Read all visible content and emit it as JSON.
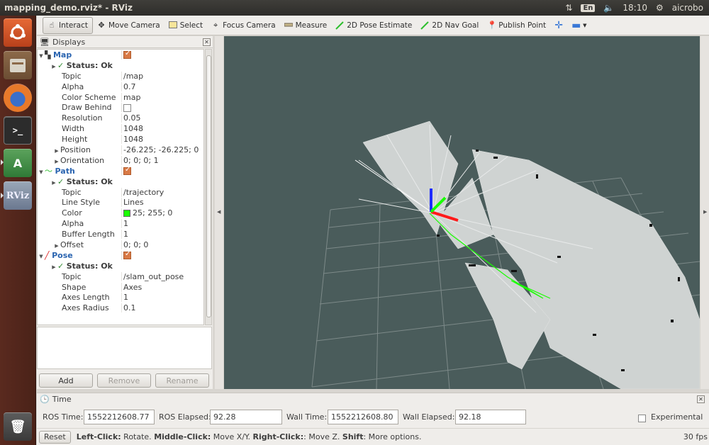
{
  "window": {
    "title": "mapping_demo.rviz* - RViz",
    "keyboard": "En",
    "clock": "18:10",
    "user": "aicrobo"
  },
  "launcher": {
    "terminal_glyph": ">_",
    "rviz_label": "RViz"
  },
  "toolbar": {
    "tools": [
      {
        "label": "Interact",
        "icon": "hand-pointer-icon"
      },
      {
        "label": "Move Camera",
        "icon": "move-camera-icon"
      },
      {
        "label": "Select",
        "icon": "select-box-icon"
      },
      {
        "label": "Focus Camera",
        "icon": "crosshair-icon"
      },
      {
        "label": "Measure",
        "icon": "ruler-icon"
      },
      {
        "label": "2D Pose Estimate",
        "icon": "green-arrow-icon"
      },
      {
        "label": "2D Nav Goal",
        "icon": "green-arrow-icon"
      },
      {
        "label": "Publish Point",
        "icon": "map-pin-icon"
      }
    ],
    "accent_green": "#2fbf2f",
    "accent_blue": "#3a78d6"
  },
  "displays": {
    "title": "Displays",
    "map": {
      "name": "Map",
      "status": "Status: Ok",
      "props": [
        {
          "key": "Topic",
          "value": "/map"
        },
        {
          "key": "Alpha",
          "value": "0.7"
        },
        {
          "key": "Color Scheme",
          "value": "map"
        },
        {
          "key": "Draw Behind",
          "value": ""
        },
        {
          "key": "Resolution",
          "value": "0.05"
        },
        {
          "key": "Width",
          "value": "1048"
        },
        {
          "key": "Height",
          "value": "1048"
        },
        {
          "key": "Position",
          "value": "-26.225; -26.225; 0"
        },
        {
          "key": "Orientation",
          "value": "0; 0; 0; 1"
        }
      ]
    },
    "path": {
      "name": "Path",
      "status": "Status: Ok",
      "props": [
        {
          "key": "Topic",
          "value": "/trajectory"
        },
        {
          "key": "Line Style",
          "value": "Lines"
        },
        {
          "key": "Color",
          "value": "25; 255; 0"
        },
        {
          "key": "Alpha",
          "value": "1"
        },
        {
          "key": "Buffer Length",
          "value": "1"
        },
        {
          "key": "Offset",
          "value": "0; 0; 0"
        }
      ]
    },
    "pose": {
      "name": "Pose",
      "status": "Status: Ok",
      "props": [
        {
          "key": "Topic",
          "value": "/slam_out_pose"
        },
        {
          "key": "Shape",
          "value": "Axes"
        },
        {
          "key": "Axes Length",
          "value": "1"
        },
        {
          "key": "Axes Radius",
          "value": "0.1"
        }
      ]
    },
    "buttons": {
      "add": "Add",
      "remove": "Remove",
      "rename": "Rename"
    }
  },
  "time": {
    "title": "Time",
    "ros_time_label": "ROS Time:",
    "ros_time": "1552212608.77",
    "ros_elapsed_label": "ROS Elapsed:",
    "ros_elapsed": "92.28",
    "wall_time_label": "Wall Time:",
    "wall_time": "1552212608.80",
    "wall_elapsed_label": "Wall Elapsed:",
    "wall_elapsed": "92.18",
    "experimental": "Experimental"
  },
  "status": {
    "reset": "Reset",
    "hint_left_b": "Left-Click:",
    "hint_left": " Rotate. ",
    "hint_mid_b": "Middle-Click:",
    "hint_mid": " Move X/Y. ",
    "hint_right_b": "Right-Click:",
    "hint_right": ": Move Z. ",
    "hint_shift_b": "Shift",
    "hint_shift": ": More options.",
    "fps": "30 fps"
  }
}
